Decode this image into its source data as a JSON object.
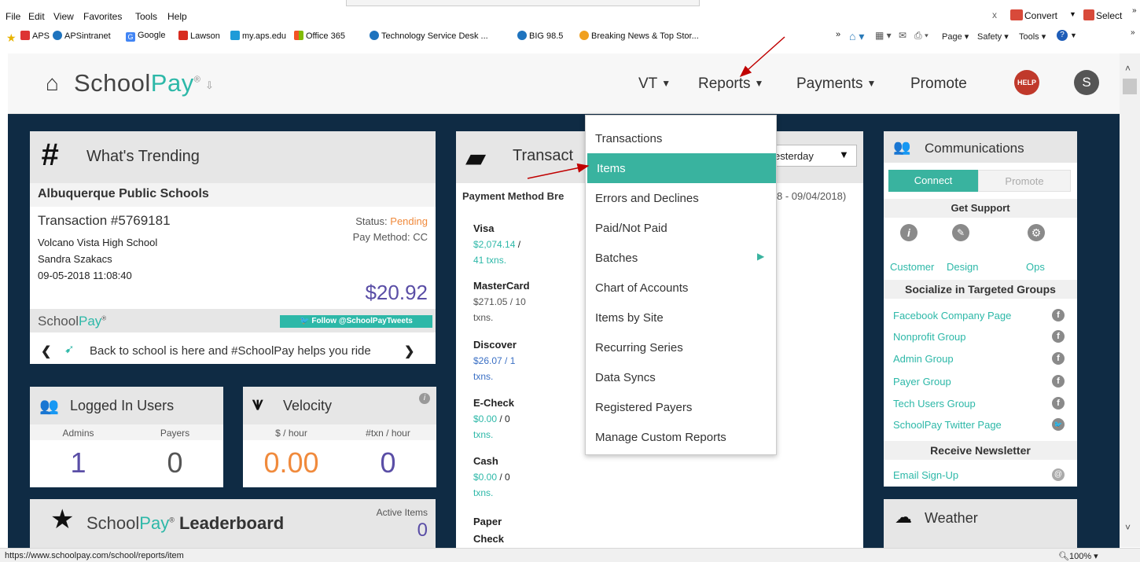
{
  "browser": {
    "menu": [
      "File",
      "Edit",
      "View",
      "Favorites",
      "Tools",
      "Help"
    ],
    "right_tools": {
      "close": "x",
      "convert": "Convert",
      "select": "Select"
    },
    "favorites": [
      "APS",
      "APSintranet",
      "Google",
      "Lawson",
      "my.aps.edu",
      "Office 365",
      "Technology Service Desk ...",
      "BIG 98.5",
      "Breaking News & Top Stor..."
    ],
    "command_bar": {
      "page": "Page",
      "safety": "Safety",
      "tools": "Tools"
    },
    "status_url": "https://www.schoolpay.com/school/reports/item",
    "zoom": "100%"
  },
  "header": {
    "logo_prefix": "School",
    "logo_suffix": "Pay",
    "nav": {
      "vt": "VT",
      "reports": "Reports",
      "payments": "Payments",
      "promote": "Promote"
    },
    "help_label": "HELP",
    "avatar_initial": "S"
  },
  "trending": {
    "title": "What's Trending",
    "district": "Albuquerque Public Schools",
    "txn_title": "Transaction #5769181",
    "status_label": "Status:",
    "status_value": "Pending",
    "pay_method_label": "Pay Method:",
    "pay_method_value": "CC",
    "school": "Volcano Vista High School",
    "person": "Sandra Szakacs",
    "datetime": "09-05-2018 11:08:40",
    "amount": "$20.92",
    "brand_prefix": "School",
    "brand_suffix": "Pay",
    "follow_label": "Follow @SchoolPayTweets",
    "ticker": "Back to school is here and #SchoolPay helps you ride"
  },
  "logged_in": {
    "title": "Logged In Users",
    "col1": "Admins",
    "col2": "Payers",
    "val1": "1",
    "val2": "0"
  },
  "velocity": {
    "title": "Velocity",
    "col1": "$ / hour",
    "col2": "#txn / hour",
    "val1": "0.00",
    "val2": "0"
  },
  "leaderboard": {
    "prefix": "School",
    "suffix": "Pay",
    "title": "Leaderboard",
    "active_label": "Active Items",
    "active_value": "0"
  },
  "transactions": {
    "title_visible": "Transact",
    "filter_value": "esterday",
    "subtitle": "Payment Method Bre",
    "date_range": "8 - 09/04/2018)",
    "methods": [
      {
        "name": "Visa",
        "amount": "$2,074.14",
        "sep": "/",
        "count": "41 txns."
      },
      {
        "name": "MasterCard",
        "amount": "$271.05",
        "sep": "/ 10",
        "count": "txns."
      },
      {
        "name": "Discover",
        "amount": "$26.07",
        "sep": "/ 1",
        "count": "txns."
      },
      {
        "name": "E-Check",
        "amount": "$0.00",
        "sep": "/ 0",
        "count": "txns."
      },
      {
        "name": "Cash",
        "amount": "$0.00",
        "sep": "/ 0",
        "count": "txns."
      },
      {
        "name": "Paper Check",
        "amount": "",
        "sep": "",
        "count": ""
      }
    ]
  },
  "reports_menu": {
    "items": [
      "Transactions",
      "Items",
      "Errors and Declines",
      "Paid/Not Paid",
      "Batches",
      "Chart of Accounts",
      "Items by Site",
      "Recurring Series",
      "Data Syncs",
      "Registered Payers",
      "Manage Custom Reports"
    ],
    "active_index": 1
  },
  "communications": {
    "title": "Communications",
    "tab_connect": "Connect",
    "tab_promote": "Promote",
    "get_support": "Get Support",
    "support": [
      "Customer",
      "Design",
      "Ops"
    ],
    "socialize_title": "Socialize in Targeted Groups",
    "groups": [
      "Facebook Company Page",
      "Nonprofit Group",
      "Admin Group",
      "Payer Group",
      "Tech Users Group",
      "SchoolPay Twitter Page"
    ],
    "newsletter_title": "Receive Newsletter",
    "newsletter_link": "Email Sign-Up"
  },
  "weather": {
    "title": "Weather"
  },
  "colors": {
    "teal": "#39b39f",
    "navy": "#0f2b44",
    "purple": "#5a4ea6",
    "orange": "#f08a3c",
    "arrow": "#c00000"
  }
}
